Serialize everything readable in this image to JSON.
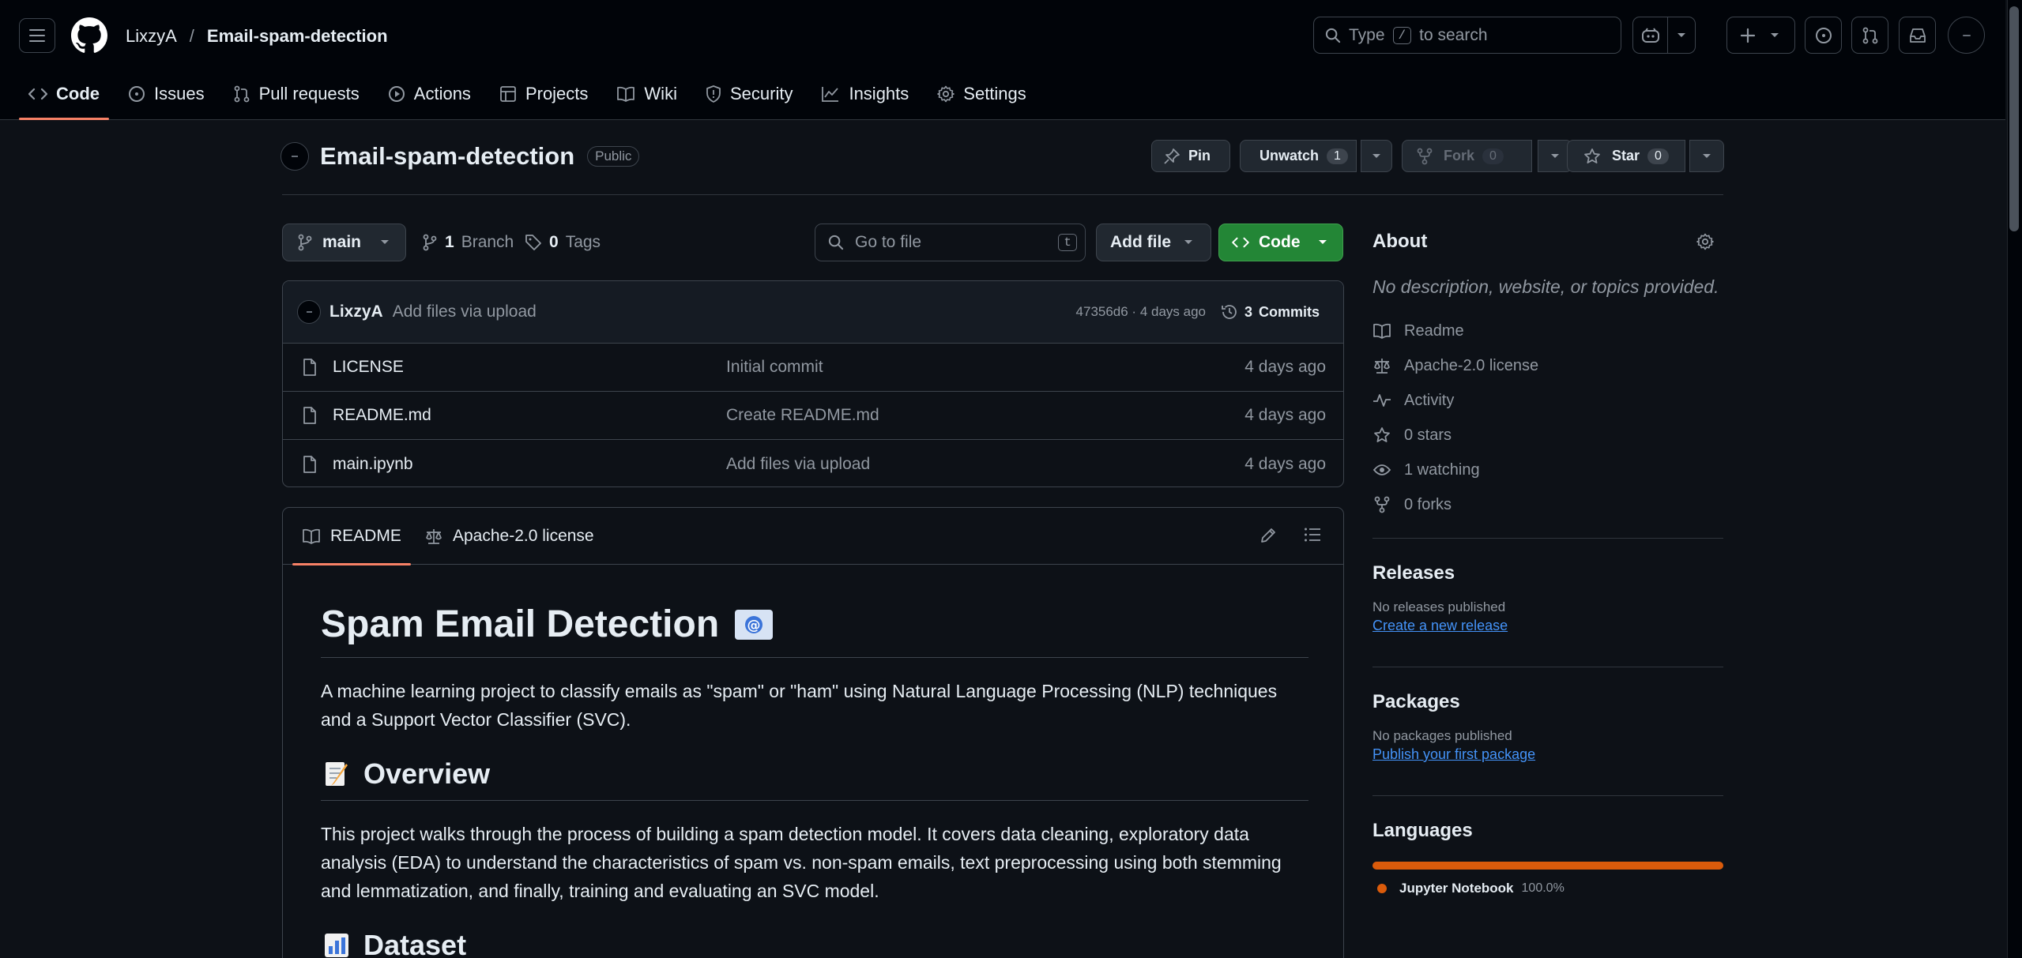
{
  "header": {
    "owner": "LixzyA",
    "separator": "/",
    "repo": "Email-spam-detection",
    "search_prefix": "Type",
    "search_key": "/",
    "search_suffix": "to search"
  },
  "nav": {
    "tabs": [
      {
        "label": "Code",
        "icon": "code-icon"
      },
      {
        "label": "Issues",
        "icon": "issue-icon"
      },
      {
        "label": "Pull requests",
        "icon": "pull-request-icon"
      },
      {
        "label": "Actions",
        "icon": "play-icon"
      },
      {
        "label": "Projects",
        "icon": "table-icon"
      },
      {
        "label": "Wiki",
        "icon": "book-icon"
      },
      {
        "label": "Security",
        "icon": "shield-icon"
      },
      {
        "label": "Insights",
        "icon": "graph-icon"
      },
      {
        "label": "Settings",
        "icon": "gear-icon"
      }
    ]
  },
  "repo": {
    "name": "Email-spam-detection",
    "visibility": "Public",
    "pin_label": "Pin",
    "watch_label": "Unwatch",
    "watch_count": "1",
    "fork_label": "Fork",
    "fork_count": "0",
    "star_label": "Star",
    "star_count": "0"
  },
  "toolbar": {
    "branch": "main",
    "branch_count": "1",
    "branch_word": "Branch",
    "tag_count": "0",
    "tag_word": "Tags",
    "goto_placeholder": "Go to file",
    "goto_key": "t",
    "add_file_label": "Add file",
    "code_label": "Code"
  },
  "commit": {
    "author": "LixzyA",
    "message": "Add files via upload",
    "sha_time": "47356d6 · 4 days ago",
    "commits_count": "3",
    "commits_word": "Commits"
  },
  "files": [
    {
      "name": "LICENSE",
      "message": "Initial commit",
      "date": "4 days ago"
    },
    {
      "name": "README.md",
      "message": "Create README.md",
      "date": "4 days ago"
    },
    {
      "name": "main.ipynb",
      "message": "Add files via upload",
      "date": "4 days ago"
    }
  ],
  "readme": {
    "tab_readme": "README",
    "tab_license": "Apache-2.0 license",
    "h1": "Spam Email Detection",
    "p1": "A machine learning project to classify emails as \"spam\" or \"ham\" using Natural Language Processing (NLP) techniques and a Support Vector Classifier (SVC).",
    "h2_overview": "Overview",
    "p2": "This project walks through the process of building a spam detection model. It covers data cleaning, exploratory data analysis (EDA) to understand the characteristics of spam vs. non-spam emails, text preprocessing using both stemming and lemmatization, and finally, training and evaluating an SVC model.",
    "h2_dataset": "Dataset"
  },
  "about": {
    "title": "About",
    "description": "No description, website, or topics provided.",
    "items": [
      {
        "label": "Readme",
        "icon": "book-icon"
      },
      {
        "label": "Apache-2.0 license",
        "icon": "law-icon"
      },
      {
        "label": "Activity",
        "icon": "pulse-icon"
      },
      {
        "label": "0 stars",
        "icon": "star-icon"
      },
      {
        "label": "1 watching",
        "icon": "eye-icon"
      },
      {
        "label": "0 forks",
        "icon": "fork-icon"
      }
    ]
  },
  "releases": {
    "title": "Releases",
    "empty": "No releases published",
    "link": "Create a new release"
  },
  "packages": {
    "title": "Packages",
    "empty": "No packages published",
    "link": "Publish your first package"
  },
  "languages": {
    "title": "Languages",
    "items": [
      {
        "name": "Jupyter Notebook",
        "percent": "100.0%",
        "share": 1.0,
        "color": "#DA5B0B"
      }
    ]
  },
  "colors": {
    "accent_underline": "#f78166",
    "code_button": "#238636",
    "link": "#4493f8"
  }
}
